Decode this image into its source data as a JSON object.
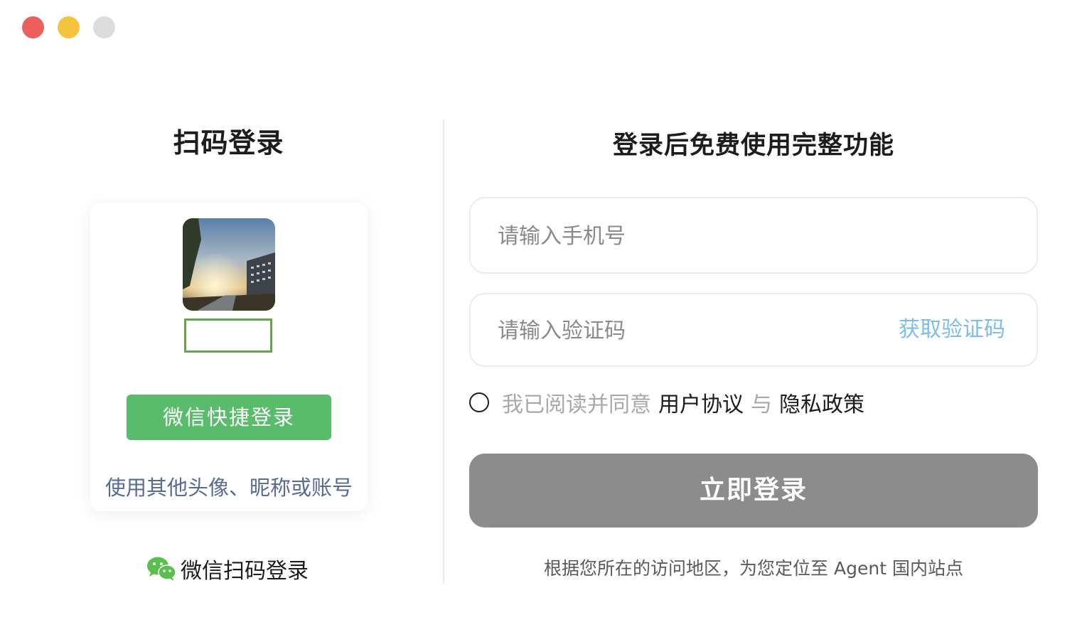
{
  "window": {
    "controls": [
      "close",
      "minimize",
      "maximize"
    ]
  },
  "qr_panel": {
    "title": "扫码登录",
    "avatar_icon": "user-avatar-photo",
    "nickname": "",
    "wechat_quick_login": "微信快捷登录",
    "other_account_link": "使用其他头像、昵称或账号",
    "footer_icon": "wechat-icon",
    "footer_label": "微信扫码登录"
  },
  "login_panel": {
    "title": "登录后免费使用完整功能",
    "phone": {
      "value": "",
      "placeholder": "请输入手机号"
    },
    "code": {
      "value": "",
      "placeholder": "请输入验证码",
      "get_code": "获取验证码"
    },
    "agreement": {
      "checked": false,
      "lead": "我已阅读并同意",
      "user_agreement": "用户协议",
      "conjunction": "与",
      "privacy_policy": "隐私政策"
    },
    "submit": "立即登录",
    "region_note": "根据您所在的访问地区，为您定位至 Agent 国内站点"
  },
  "colors": {
    "wechat_green": "#59bc6b",
    "link_blue": "#576b95",
    "get_code_blue": "#7cbcf0",
    "disabled_button": "#8c8c8c"
  }
}
